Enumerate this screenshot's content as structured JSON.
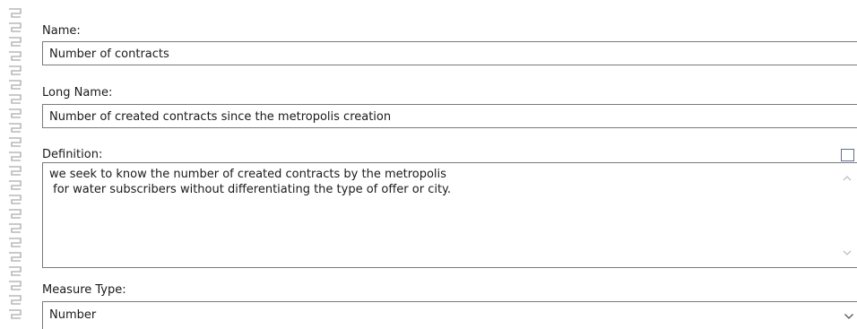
{
  "form": {
    "name": {
      "label": "Name:",
      "value": "Number of contracts"
    },
    "long_name": {
      "label": "Long Name:",
      "value": "Number of created contracts since the metropolis creation"
    },
    "definition": {
      "label": "Definition:",
      "lines": [
        "we seek to know the number of created contracts by the metropolis",
        " for water subscribers without differentiating the type of offer or city."
      ]
    },
    "measure_type": {
      "label": "Measure Type:",
      "value": "Number"
    }
  },
  "icons": {
    "binding": "spiral-binding-icon",
    "expand": "expand-square-icon",
    "scroll_up": "chevron-up-icon",
    "scroll_down": "chevron-down-icon",
    "dropdown": "chevron-down-icon"
  },
  "colors": {
    "border": "#7a7a7a",
    "binding": "#b9b9b9",
    "expand_toggle": "#5d6f8c",
    "scroll_arrow": "#c0c0c0"
  }
}
